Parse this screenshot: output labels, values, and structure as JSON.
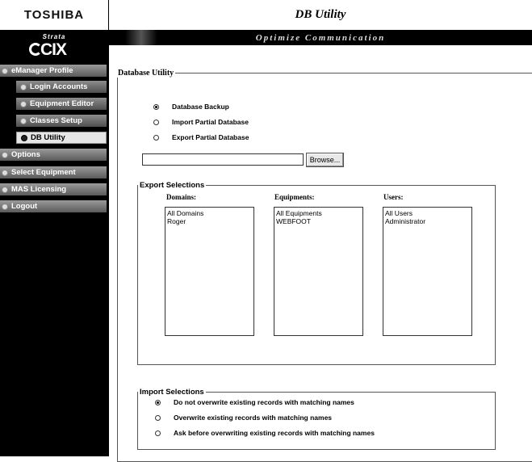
{
  "app": {
    "brand": "TOSHIBA",
    "product_line": "Strata",
    "product": "CIX"
  },
  "header": {
    "title": "DB Utility",
    "banner": "Optimize Communication"
  },
  "sidebar": {
    "items": [
      {
        "label": "eManager Profile",
        "level": "top"
      },
      {
        "label": "Login Accounts",
        "level": "sub"
      },
      {
        "label": "Equipment Editor",
        "level": "sub"
      },
      {
        "label": "Classes Setup",
        "level": "sub"
      },
      {
        "label": "DB Utility",
        "level": "sub",
        "active": true
      },
      {
        "label": "Options",
        "level": "top"
      },
      {
        "label": "Select Equipment",
        "level": "top"
      },
      {
        "label": "MAS Licensing",
        "level": "top"
      },
      {
        "label": "Logout",
        "level": "top"
      }
    ]
  },
  "main": {
    "section_title": "Database Utility",
    "operations": [
      {
        "label": "Database Backup",
        "selected": true
      },
      {
        "label": "Import Partial Database",
        "selected": false
      },
      {
        "label": "Export Partial Database",
        "selected": false
      }
    ],
    "file_input": {
      "value": ""
    },
    "browse_label": "Browse...",
    "export": {
      "title": "Export Selections",
      "columns": [
        {
          "header": "Domains:",
          "items": [
            "All Domains",
            "Roger"
          ]
        },
        {
          "header": "Equipments:",
          "items": [
            "All Equipments",
            "WEBFOOT"
          ]
        },
        {
          "header": "Users:",
          "items": [
            "All Users",
            "Administrator"
          ]
        }
      ]
    },
    "import": {
      "title": "Import Selections",
      "options": [
        {
          "label": "Do not overwrite existing records with matching names",
          "selected": true
        },
        {
          "label": "Overwrite existing records with matching names",
          "selected": false
        },
        {
          "label": "Ask before overwriting existing records with matching names",
          "selected": false
        }
      ]
    }
  }
}
